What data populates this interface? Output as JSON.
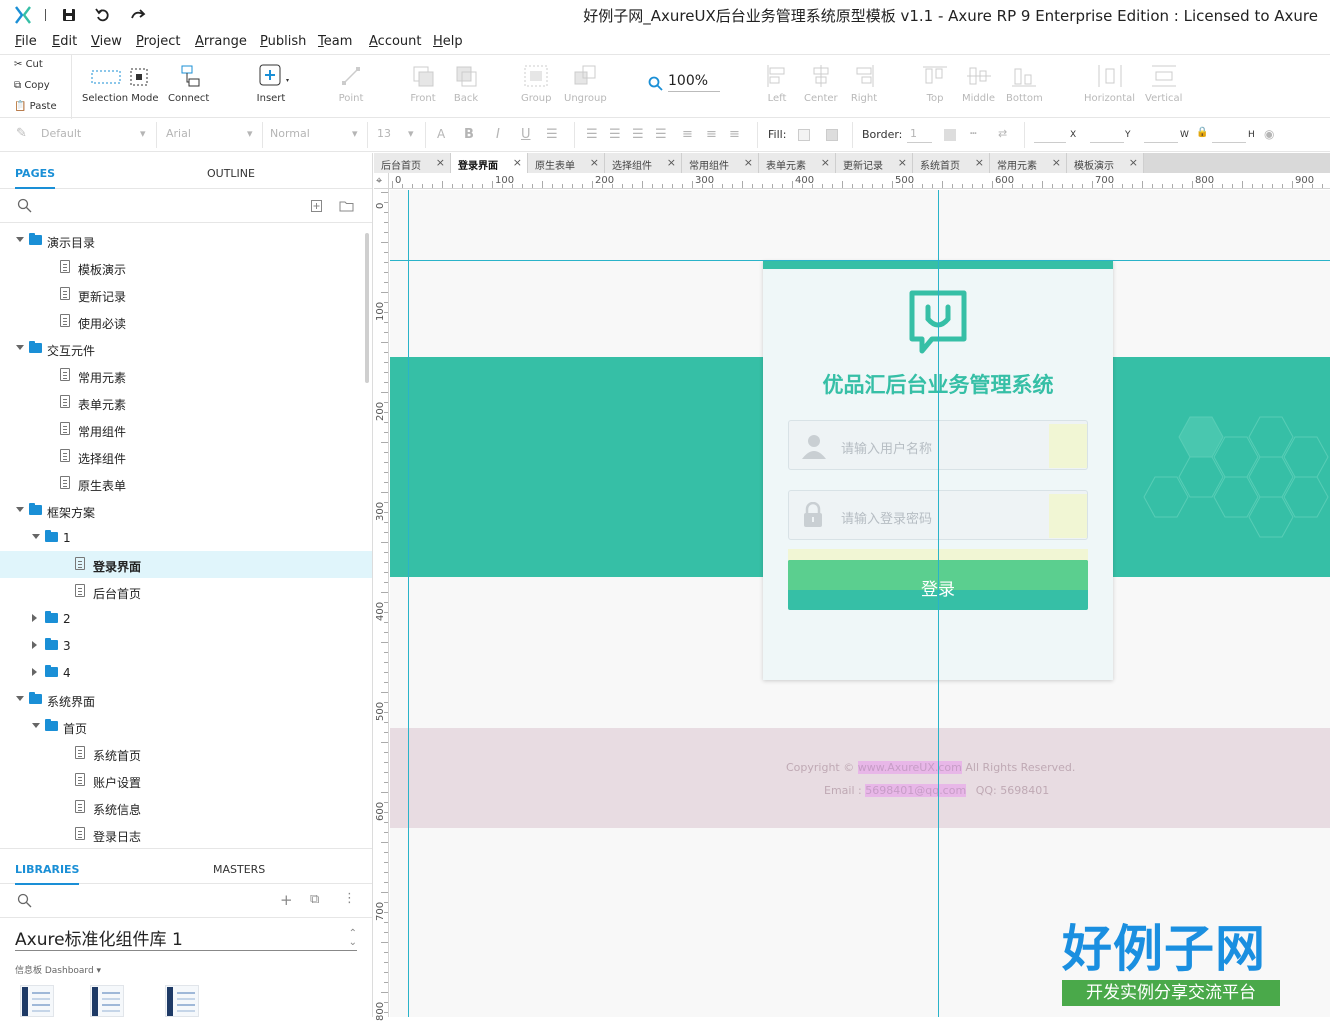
{
  "window": {
    "title": "好例子网_AxureUX后台业务管理系统原型模板 v1.1 - Axure RP 9 Enterprise Edition : Licensed to Axure"
  },
  "menu": {
    "items": [
      {
        "label": "File",
        "key": "F",
        "rest": "ile"
      },
      {
        "label": "Edit",
        "key": "E",
        "rest": "dit"
      },
      {
        "label": "View",
        "key": "V",
        "rest": "iew"
      },
      {
        "label": "Project",
        "key": "P",
        "rest": "roject"
      },
      {
        "label": "Arrange",
        "key": "A",
        "rest": "rrange"
      },
      {
        "label": "Publish",
        "key": "P",
        "rest": "ublish"
      },
      {
        "label": "Team",
        "key": "T",
        "rest": "eam"
      },
      {
        "label": "Account",
        "key": "A",
        "rest": "ccount"
      },
      {
        "label": "Help",
        "key": "H",
        "rest": "elp"
      }
    ]
  },
  "toolbar": {
    "cut": "Cut",
    "copy": "Copy",
    "paste": "Paste",
    "selection_mode": "Selection Mode",
    "connect": "Connect",
    "insert": "Insert",
    "point": "Point",
    "front": "Front",
    "back": "Back",
    "group": "Group",
    "ungroup": "Ungroup",
    "zoom": "100%",
    "left": "Left",
    "center": "Center",
    "right": "Right",
    "top": "Top",
    "middle": "Middle",
    "bottom": "Bottom",
    "horizontal": "Horizontal",
    "vertical": "Vertical"
  },
  "stylebar": {
    "style": "Default",
    "font": "Arial",
    "weight": "Normal",
    "size": "13",
    "fill_label": "Fill:",
    "border_label": "Border:",
    "border_value": "1",
    "x_label": "X",
    "y_label": "Y",
    "w_label": "W",
    "h_label": "H"
  },
  "pages_panel": {
    "tab_pages": "PAGES",
    "tab_outline": "OUTLINE",
    "tree": [
      {
        "label": "演示目录",
        "type": "folder",
        "level": 0,
        "expanded": true
      },
      {
        "label": "模板演示",
        "type": "page",
        "level": 1
      },
      {
        "label": "更新记录",
        "type": "page",
        "level": 1
      },
      {
        "label": "使用必读",
        "type": "page",
        "level": 1
      },
      {
        "label": "交互元件",
        "type": "folder",
        "level": 0,
        "expanded": true
      },
      {
        "label": "常用元素",
        "type": "page",
        "level": 1
      },
      {
        "label": "表单元素",
        "type": "page",
        "level": 1
      },
      {
        "label": "常用组件",
        "type": "page",
        "level": 1
      },
      {
        "label": "选择组件",
        "type": "page",
        "level": 1
      },
      {
        "label": "原生表单",
        "type": "page",
        "level": 1
      },
      {
        "label": "框架方案",
        "type": "folder",
        "level": 0,
        "expanded": true
      },
      {
        "label": "1",
        "type": "folder",
        "level": 1,
        "expanded": true
      },
      {
        "label": "登录界面",
        "type": "page",
        "level": 2,
        "selected": true
      },
      {
        "label": "后台首页",
        "type": "page",
        "level": 2
      },
      {
        "label": "2",
        "type": "folder",
        "level": 1,
        "expanded": false
      },
      {
        "label": "3",
        "type": "folder",
        "level": 1,
        "expanded": false
      },
      {
        "label": "4",
        "type": "folder",
        "level": 1,
        "expanded": false
      },
      {
        "label": "系统界面",
        "type": "folder",
        "level": 0,
        "expanded": true
      },
      {
        "label": "首页",
        "type": "folder",
        "level": 1,
        "expanded": true
      },
      {
        "label": "系统首页",
        "type": "page",
        "level": 2
      },
      {
        "label": "账户设置",
        "type": "page",
        "level": 2
      },
      {
        "label": "系统信息",
        "type": "page",
        "level": 2
      },
      {
        "label": "登录日志",
        "type": "page",
        "level": 2
      }
    ]
  },
  "libraries_panel": {
    "tab_libraries": "LIBRARIES",
    "tab_masters": "MASTERS",
    "library": "Axure标准化组件库 1",
    "category": "信息板 Dashboard ▾"
  },
  "doc_tabs": [
    {
      "label": "后台首页",
      "active": false
    },
    {
      "label": "登录界面",
      "active": true
    },
    {
      "label": "原生表单",
      "active": false
    },
    {
      "label": "选择组件",
      "active": false
    },
    {
      "label": "常用组件",
      "active": false
    },
    {
      "label": "表单元素",
      "active": false
    },
    {
      "label": "更新记录",
      "active": false
    },
    {
      "label": "系统首页",
      "active": false
    },
    {
      "label": "常用元素",
      "active": false
    },
    {
      "label": "模板演示",
      "active": false
    }
  ],
  "rulers": {
    "h": [
      "0",
      "100",
      "200",
      "300",
      "400",
      "500",
      "600",
      "700",
      "800",
      "900"
    ],
    "v": [
      "0",
      "100",
      "200",
      "300",
      "400",
      "500",
      "600",
      "700",
      "800"
    ]
  },
  "login_page": {
    "title": "优品汇后台业务管理系统",
    "username_placeholder": "请输入用户名称",
    "password_placeholder": "请输入登录密码",
    "login_button": "登录",
    "copyright_prefix": "Copyright ©",
    "copyright_site": "www.AxureUX.com",
    "copyright_suffix": "All Rights Reserved.",
    "email_prefix": "Email :",
    "email_value": "5698401@qq.com",
    "qq_text": "QQ: 5698401"
  },
  "watermark": {
    "brand": "好例子网",
    "slogan": "开发实例分享交流平台"
  },
  "colors": {
    "accent": "#1a8fd6",
    "brand_green": "#36bfa6",
    "button_light": "#5bcf8f",
    "guide": "#2ab3c9"
  }
}
